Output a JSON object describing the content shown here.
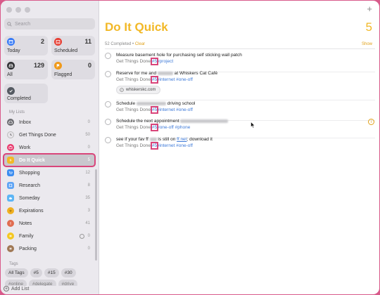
{
  "sidebar": {
    "search_placeholder": "Search",
    "smart_lists": [
      {
        "label": "Today",
        "count": "2",
        "icon": "calendar-icon",
        "color": "#3478f6"
      },
      {
        "label": "Scheduled",
        "count": "11",
        "icon": "calendar-scheduled-icon",
        "color": "#e63b30"
      },
      {
        "label": "All",
        "count": "129",
        "icon": "tray-icon",
        "color": "#333438"
      },
      {
        "label": "Flagged",
        "count": "0",
        "icon": "flag-icon",
        "color": "#f09a1a"
      },
      {
        "label": "Completed",
        "count": "",
        "icon": "checkmark-icon",
        "color": "#555a62"
      }
    ],
    "my_lists_heading": "My Lists",
    "lists": [
      {
        "label": "Inbox",
        "count": "0",
        "icon": "inbox-icon",
        "color": "#6d6d72"
      },
      {
        "label": "Get Things Done",
        "count": "50",
        "icon": "clock-icon",
        "color": "#e8e5ea"
      },
      {
        "label": "Work",
        "count": "0",
        "icon": "briefcase-icon",
        "color": "#e8386c"
      },
      {
        "label": "Do It Quick",
        "count": "5",
        "icon": "bolt-icon",
        "color": "#f2b826"
      },
      {
        "label": "Shopping",
        "count": "12",
        "icon": "shopping-cart-icon",
        "color": "#3c8df0"
      },
      {
        "label": "Research",
        "count": "8",
        "icon": "research-icon",
        "color": "#5ea4f5"
      },
      {
        "label": "Someday",
        "count": "35",
        "icon": "cloud-icon",
        "color": "#5db5f5"
      },
      {
        "label": "Expirations",
        "count": "3",
        "icon": "face-icon",
        "color": "#f0b020"
      },
      {
        "label": "Notes",
        "count": "41",
        "icon": "note-icon",
        "color": "#e06c50"
      },
      {
        "label": "Family",
        "count": "0",
        "icon": "family-icon",
        "color": "#f4c822"
      },
      {
        "label": "Packing",
        "count": "0",
        "icon": "box-icon",
        "color": "#a07855"
      }
    ],
    "tags_heading": "Tags",
    "tags": [
      "All Tags",
      "#5",
      "#15",
      "#30",
      "#online",
      "#delegate",
      "#drive"
    ],
    "add_list": "Add List"
  },
  "main": {
    "title": "Do It Quick",
    "count": "5",
    "completed_text": "52 Completed",
    "separator": "•",
    "clear_label": "Clear",
    "show_label": "Show",
    "accent_color": "#f2b826",
    "tasks": [
      {
        "title_a": "Measure basement hole for purchasing self sticking wall patch",
        "title_b": "",
        "list": "Get Things Done",
        "tag5": "#5",
        "tags": "#project",
        "link": ""
      },
      {
        "title_a": "Reserve for me and",
        "title_b": "at Whiskers Cat Café",
        "list": "Get Things Done",
        "tag5": "#5",
        "tags": "#internet #one-off",
        "link": "whiskerskc.com"
      },
      {
        "title_a": "Schedule",
        "title_b": "driving school",
        "list": "Get Things Done",
        "tag5": "#5",
        "tags": "#internet #one-off",
        "link": ""
      },
      {
        "title_a": "Schedule the next appointment",
        "title_b": "",
        "list": "Get Things Done",
        "tag5": "#5",
        "tags": "#one-off #phone",
        "link": ""
      },
      {
        "title_a": "see if your fav ff",
        "title_b": "is still on",
        "title_link": "ff.net",
        "title_c": "; download it",
        "list": "Get Things Done",
        "tag5": "#5",
        "tags": "#internet #one-off",
        "link": ""
      }
    ]
  }
}
